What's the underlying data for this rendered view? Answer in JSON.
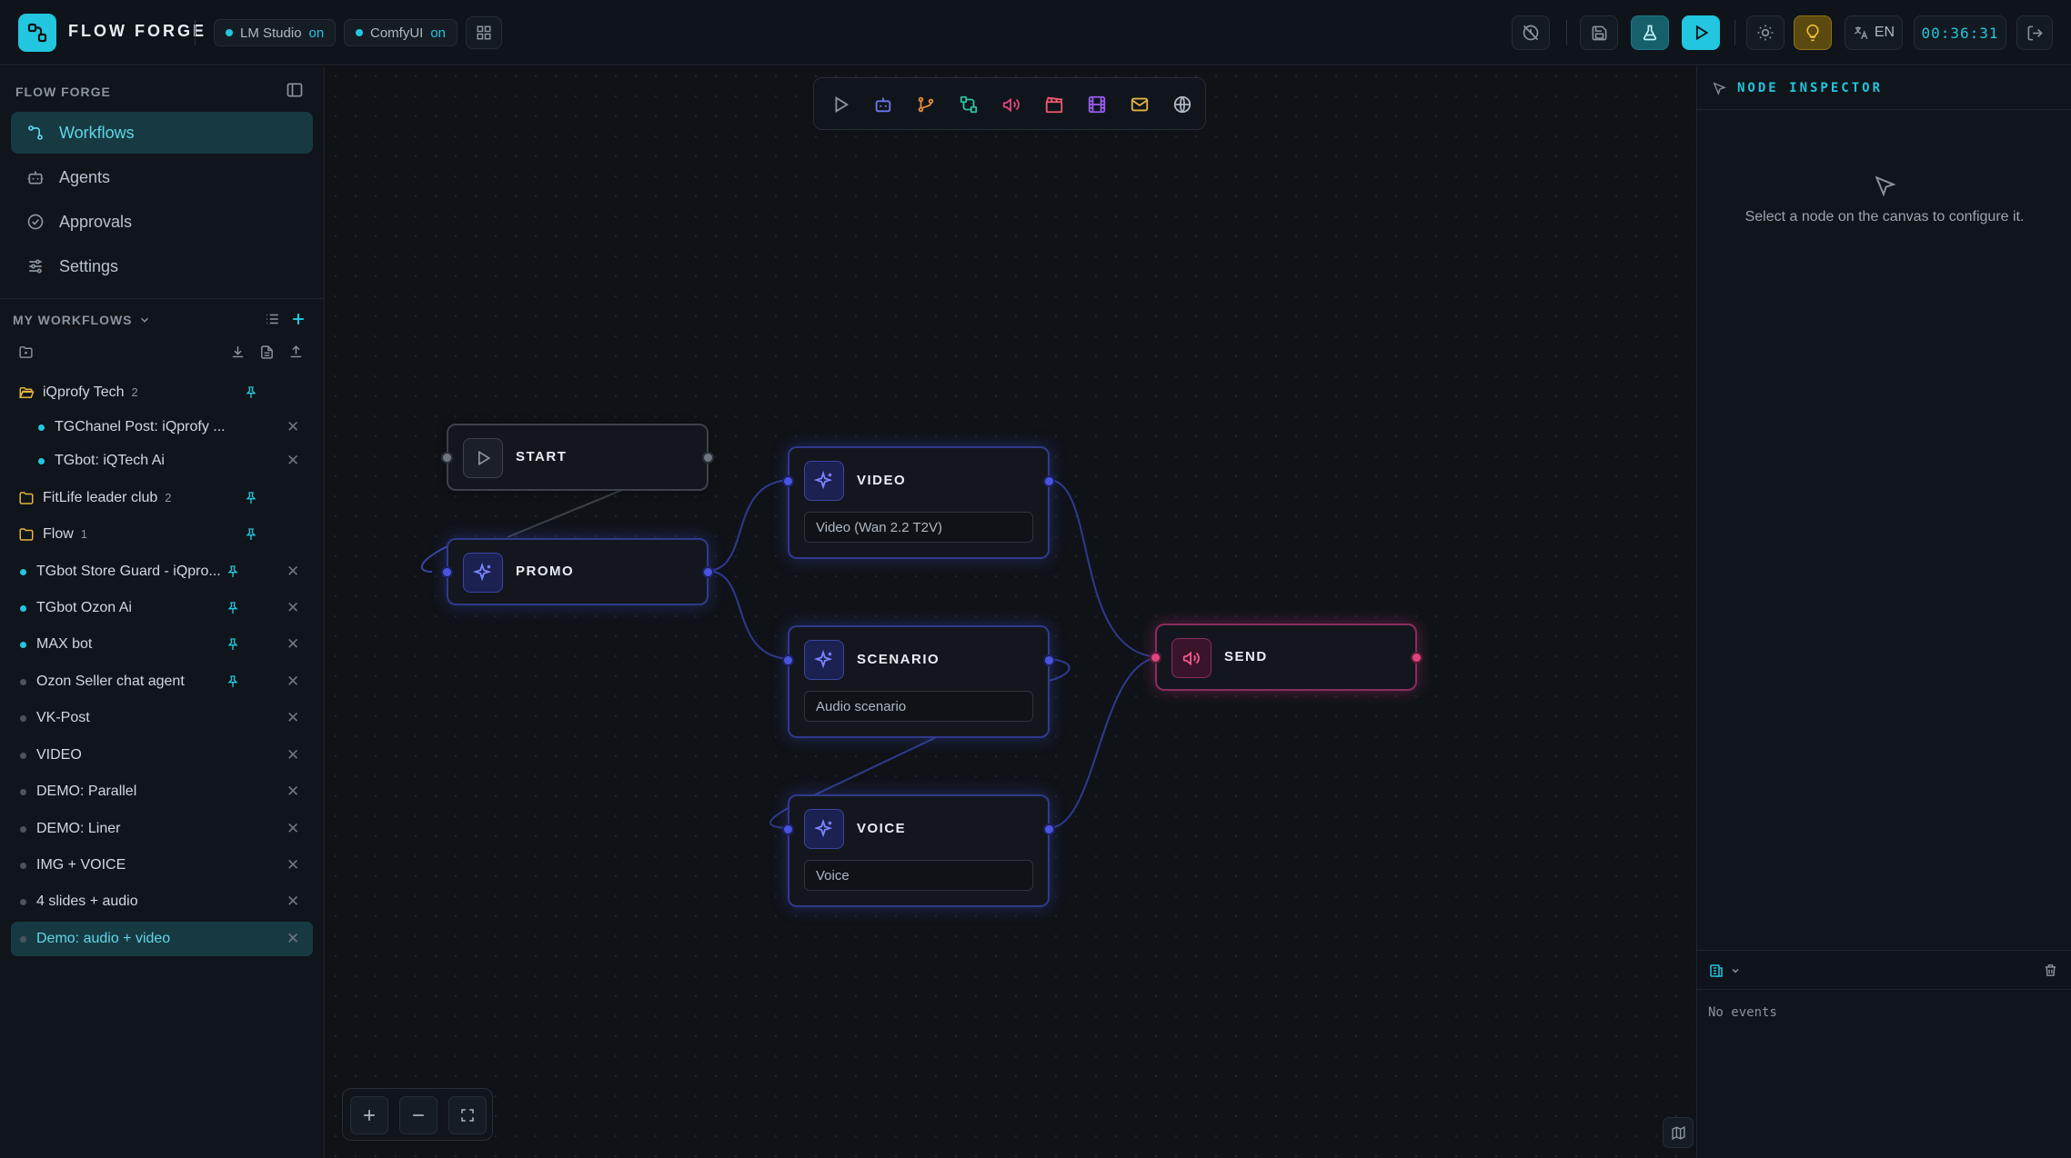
{
  "header": {
    "brand": "FLOW FORGE",
    "services": [
      {
        "name": "LM Studio",
        "status": "on"
      },
      {
        "name": "ComfyUI",
        "status": "on"
      }
    ],
    "language": "EN",
    "timer": "00:36:31"
  },
  "sidebar": {
    "title": "FLOW FORGE",
    "nav": [
      {
        "label": "Workflows",
        "icon": "workflow-icon",
        "active": true
      },
      {
        "label": "Agents",
        "icon": "bot-icon"
      },
      {
        "label": "Approvals",
        "icon": "check-circle-icon"
      },
      {
        "label": "Settings",
        "icon": "sliders-icon"
      }
    ],
    "my_workflows_title": "MY WORKFLOWS",
    "workflows": [
      {
        "label": "iQprofy Tech",
        "count": "2",
        "type": "folder"
      },
      {
        "label": "TGChanel Post: iQprofy ...",
        "type": "child"
      },
      {
        "label": "TGbot: iQTech Ai",
        "type": "child"
      },
      {
        "label": "FitLife leader club",
        "count": "2",
        "type": "folder"
      },
      {
        "label": "Flow",
        "count": "1",
        "type": "folder"
      },
      {
        "label": "TGbot Store Guard - iQpro...",
        "type": "item"
      },
      {
        "label": "TGbot Ozon Ai",
        "type": "item"
      },
      {
        "label": "MAX bot",
        "type": "item"
      },
      {
        "label": "Ozon Seller chat agent",
        "type": "item"
      },
      {
        "label": "VK-Post",
        "type": "item"
      },
      {
        "label": "VIDEO",
        "type": "item"
      },
      {
        "label": "DEMO: Parallel",
        "type": "item"
      },
      {
        "label": "DEMO: Liner",
        "type": "item"
      },
      {
        "label": "IMG + VOICE",
        "type": "item"
      },
      {
        "label": "4 slides + audio",
        "type": "item"
      },
      {
        "label": "Demo: audio + video",
        "type": "item",
        "active": true
      }
    ]
  },
  "canvas": {
    "nodes": {
      "start": {
        "title": "START"
      },
      "promo": {
        "title": "PROMO"
      },
      "video": {
        "title": "VIDEO",
        "field": "Video (Wan 2.2 T2V)"
      },
      "scenario": {
        "title": "SCENARIO",
        "field": "Audio scenario"
      },
      "voice": {
        "title": "VOICE",
        "field": "Voice"
      },
      "send": {
        "title": "SEND"
      }
    }
  },
  "inspector": {
    "title": "NODE INSPECTOR",
    "empty_text": "Select a node on the canvas to configure it.",
    "log_empty": "No events"
  },
  "colors": {
    "accent": "#22c6de",
    "node_blue": "#4954e0",
    "node_pink": "#e0457f",
    "background": "#0d1117"
  }
}
